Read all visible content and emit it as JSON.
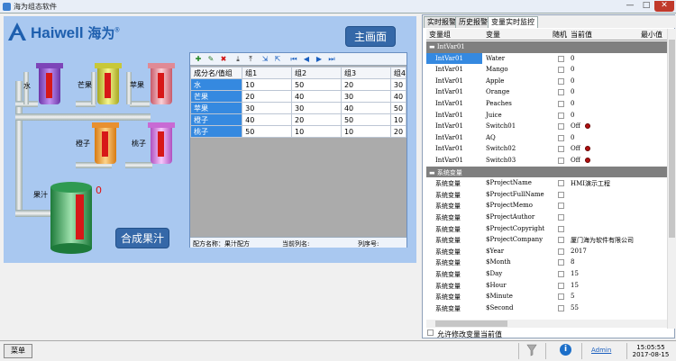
{
  "window": {
    "title": "海为组态软件",
    "min": "—",
    "max": "□",
    "close": "✕"
  },
  "brand": {
    "logo": "Haiwell",
    "logo_cn": "海为",
    "reg": "®"
  },
  "scene": {
    "main_button": "主画面",
    "juice_button": "合成果汁",
    "tanks": [
      "水",
      "芒果",
      "苹果",
      "橙子",
      "桃子"
    ],
    "mix_label": "果汁",
    "mix_value": "0"
  },
  "recipe": {
    "columns": [
      "成分名/值组",
      "组1",
      "组2",
      "组3",
      "组4"
    ],
    "rows": [
      {
        "name": "水",
        "v": [
          "10",
          "50",
          "20",
          "30"
        ]
      },
      {
        "name": "芒果",
        "v": [
          "20",
          "40",
          "30",
          "40"
        ]
      },
      {
        "name": "苹果",
        "v": [
          "30",
          "30",
          "40",
          "50"
        ]
      },
      {
        "name": "橙子",
        "v": [
          "40",
          "20",
          "50",
          "10"
        ]
      },
      {
        "name": "桃子",
        "v": [
          "50",
          "10",
          "10",
          "20"
        ]
      }
    ],
    "footer": {
      "recipe_name": "配方名称：果汁配方",
      "current_col": "当前列名:",
      "col_no": "列序号:"
    }
  },
  "panel": {
    "tabs": [
      "实时报警",
      "历史报警",
      "变量实时监控"
    ],
    "headers": [
      "变量组",
      "变量",
      "随机",
      "当前值",
      "最小值"
    ],
    "rows": [
      {
        "type": "group",
        "g": "▬ IntVar01"
      },
      {
        "g": "IntVar01",
        "v": "Water",
        "val": "0",
        "sel": true
      },
      {
        "g": "IntVar01",
        "v": "Mango",
        "val": "0"
      },
      {
        "g": "IntVar01",
        "v": "Apple",
        "val": "0"
      },
      {
        "g": "IntVar01",
        "v": "Orange",
        "val": "0"
      },
      {
        "g": "IntVar01",
        "v": "Peaches",
        "val": "0"
      },
      {
        "g": "IntVar01",
        "v": "Juice",
        "val": "0"
      },
      {
        "g": "IntVar01",
        "v": "Switch01",
        "val": "Off",
        "dot": true
      },
      {
        "g": "IntVar01",
        "v": "AQ",
        "val": "0"
      },
      {
        "g": "IntVar01",
        "v": "Switch02",
        "val": "Off",
        "dot": true
      },
      {
        "g": "IntVar01",
        "v": "Switch03",
        "val": "Off",
        "dot": true
      },
      {
        "type": "group",
        "g": "▬ 系统变量"
      },
      {
        "g": "系统变量",
        "v": "$ProjectName",
        "val": "HMI演示工程"
      },
      {
        "g": "系统变量",
        "v": "$ProjectFullName",
        "val": ""
      },
      {
        "g": "系统变量",
        "v": "$ProjectMemo",
        "val": ""
      },
      {
        "g": "系统变量",
        "v": "$ProjectAuthor",
        "val": ""
      },
      {
        "g": "系统变量",
        "v": "$ProjectCopyright",
        "val": ""
      },
      {
        "g": "系统变量",
        "v": "$ProjectCompany",
        "val": "厦门海为软件有限公司"
      },
      {
        "g": "系统变量",
        "v": "$Year",
        "val": "2017"
      },
      {
        "g": "系统变量",
        "v": "$Month",
        "val": "8"
      },
      {
        "g": "系统变量",
        "v": "$Day",
        "val": "15"
      },
      {
        "g": "系统变量",
        "v": "$Hour",
        "val": "15"
      },
      {
        "g": "系统变量",
        "v": "$Minute",
        "val": "5"
      },
      {
        "g": "系统变量",
        "v": "$Second",
        "val": "55"
      }
    ],
    "allow_label": "允许修改变量当前值"
  },
  "status": {
    "menu": "菜单",
    "user": "Admin",
    "time": "15:05:55",
    "date": "2017-08-15"
  },
  "colors": {
    "accent": "#3589e0",
    "group_row": "#7f7f7f",
    "button": "#3568a8",
    "canvas": "#a9c8f0"
  }
}
